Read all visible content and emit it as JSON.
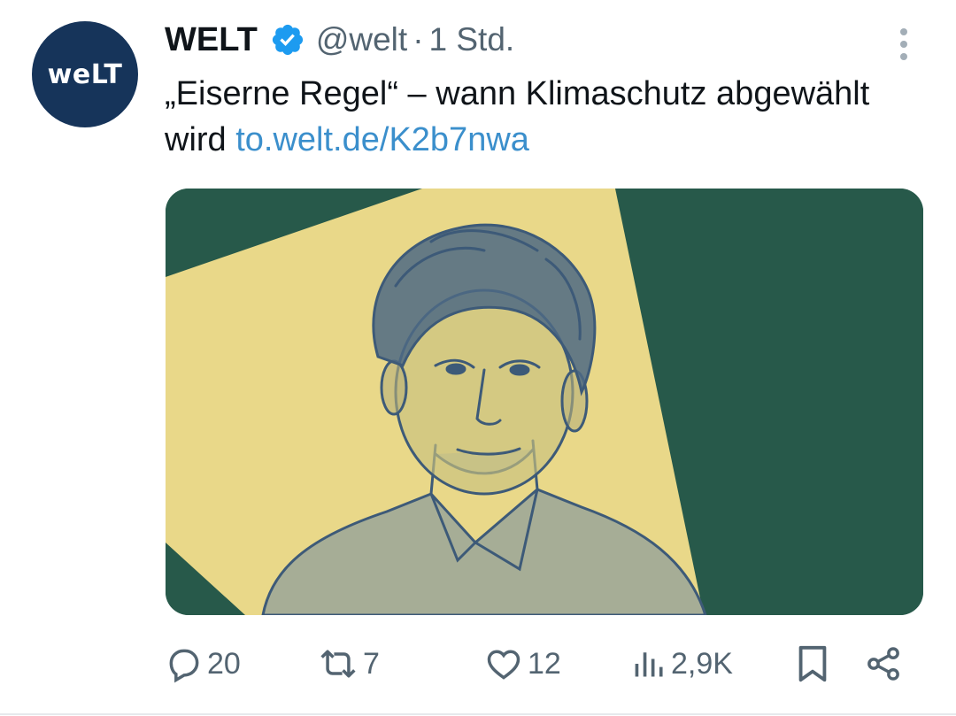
{
  "account": {
    "avatar_text": "weLT",
    "name": "WELT",
    "handle": "@welt",
    "separator": "·",
    "time": "1 Std.",
    "verified": true
  },
  "tweet": {
    "text": "„Eiserne Regel“ – wann Klimaschutz abgewählt wird ",
    "link": "to.welt.de/K2b7nwa"
  },
  "media": {
    "description_icon": "portrait-illustration",
    "colors": {
      "background": "#27594a",
      "panel": "#e9d889",
      "ink": "#3d5a78"
    }
  },
  "actions": {
    "replies": "20",
    "reposts": "7",
    "likes": "12",
    "views": "2,9K"
  },
  "colors": {
    "accent": "#1d9bf0",
    "link": "#3b8fcc",
    "muted": "#536471",
    "avatar_bg": "#16345a"
  }
}
